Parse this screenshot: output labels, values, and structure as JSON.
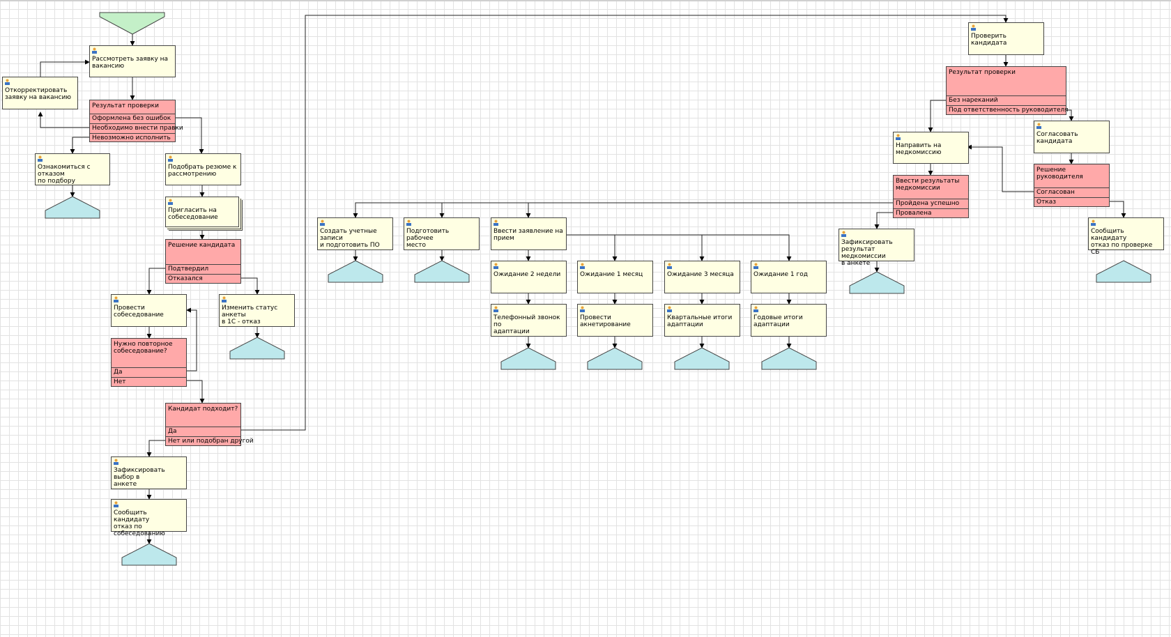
{
  "diagram": {
    "tasks": {
      "review_request": "Рассмотреть заявку на\nвакансию",
      "correct_request": "Откорректировать\nзаявку на вакансию",
      "read_refusal": "Ознакомиться с отказом\nпо подбору",
      "select_resumes": "Подобрать резюме к\nрассмотрению",
      "invite_interview": "Пригласить на\nсобеседование",
      "conduct_interview": "Провести\nсобеседование",
      "change_status": "Изменить статус анкеты\nв 1С - отказ",
      "record_choice": "Зафиксировать выбор в\nанкете",
      "notify_refusal_interview": "Сообщить кандидату\nотказ по собеседованию",
      "check_candidate": "Проверить кандидата",
      "approve_candidate": "Согласовать кандидата",
      "send_medical": "Направить на\nмедкомиссию",
      "record_medical": "Зафиксировать\nрезультат медкомиссии\nв анкете",
      "notify_refusal_sb": "Сообщить кандидату\nотказ по проверке СБ",
      "create_accounts": "Создать учетные записи\nи подготовить ПО",
      "prepare_workplace": "Подготовить рабочее\nместо",
      "enter_application": "Ввести заявление на\nприем",
      "wait_2_weeks": "Ожидание 2 недели",
      "wait_1_month": "Ожидание 1 месяц",
      "wait_3_months": "Ожидание 3 месяца",
      "wait_1_year": "Ожидание 1 год",
      "phone_call": "Телефонный звонок по\nадаптации",
      "survey": "Провести\nакнетирование",
      "quarterly_results": "Квартальные итоги\nадаптации",
      "annual_results": "Годовые итоги\nадаптации"
    },
    "decisions": {
      "check_result": {
        "title": "Результат проверки",
        "options": [
          "Оформлена без ошибок",
          "Необходимо внести правки",
          "Невозможно исполнить"
        ]
      },
      "candidate_decision": {
        "title": "Решение кандидата",
        "options": [
          "Подтвердил",
          "Отказался"
        ]
      },
      "repeat_interview": {
        "title": "Нужно повторное\nсобеседование?",
        "options": [
          "Да",
          "Нет"
        ]
      },
      "candidate_fits": {
        "title": "Кандидат подходит?",
        "options": [
          "Да",
          "Нет или подобран другой"
        ]
      },
      "verification_result": {
        "title": "Результат проверки",
        "options": [
          "Без нареканий",
          "Под ответственность руководителя"
        ]
      },
      "manager_decision": {
        "title": "Решение руководителя",
        "options": [
          "Согласован",
          "Отказ"
        ]
      },
      "medical_results": {
        "title": "Ввести результаты\nмедкомиссии",
        "options": [
          "Пройдена успешно",
          "Провалена"
        ]
      }
    },
    "colors": {
      "task": "#ffffe3",
      "decision": "#ffa9a9",
      "start": "#c4f0c8",
      "end": "#bde8ec",
      "stroke": "#444444"
    }
  }
}
